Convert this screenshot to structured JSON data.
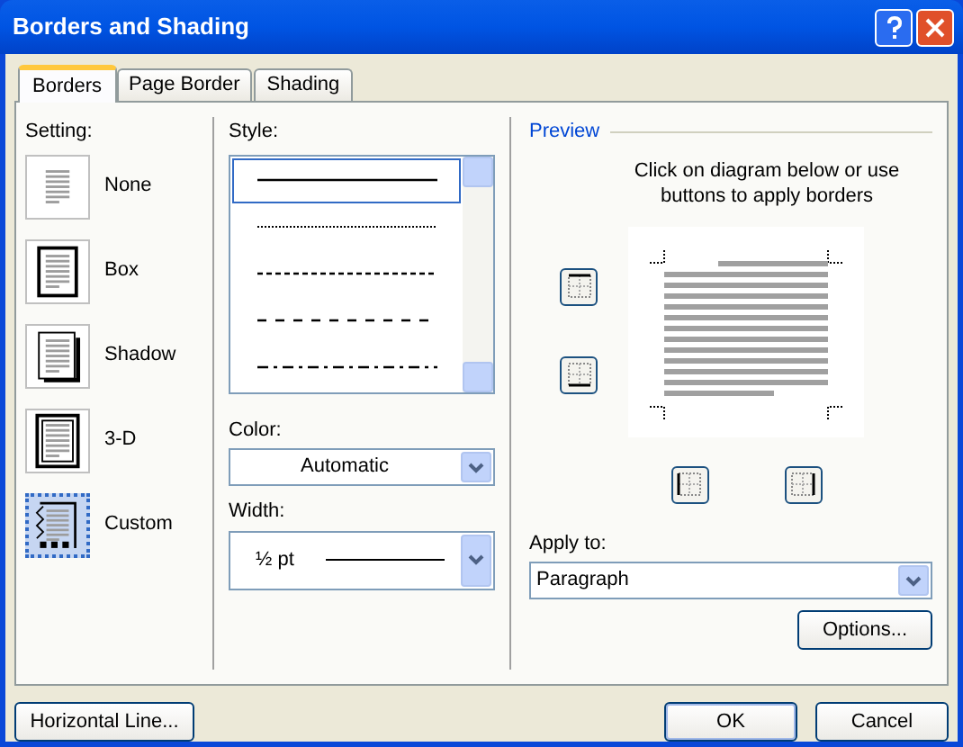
{
  "window": {
    "title": "Borders and Shading"
  },
  "tabs": [
    {
      "label": "Borders",
      "selected": true
    },
    {
      "label": "Page Border",
      "selected": false
    },
    {
      "label": "Shading",
      "selected": false
    }
  ],
  "setting": {
    "label": "Setting:",
    "options": [
      {
        "kind": "none",
        "label": "None",
        "selected": false
      },
      {
        "kind": "box",
        "label": "Box",
        "selected": false
      },
      {
        "kind": "shadow",
        "label": "Shadow",
        "selected": false
      },
      {
        "kind": "threed",
        "label": "3-D",
        "selected": false
      },
      {
        "kind": "custom",
        "label": "Custom",
        "selected": true
      }
    ]
  },
  "style": {
    "label": "Style:",
    "options": [
      {
        "kind": "solid",
        "selected": true
      },
      {
        "kind": "dotted",
        "selected": false
      },
      {
        "kind": "dashed",
        "selected": false
      },
      {
        "kind": "dash-long",
        "selected": false
      },
      {
        "kind": "dash-dot",
        "selected": false
      }
    ]
  },
  "color": {
    "label": "Color:",
    "value": "Automatic"
  },
  "width": {
    "label": "Width:",
    "value": "½ pt"
  },
  "preview": {
    "title": "Preview",
    "instructions": "Click on diagram below or use buttons to apply borders",
    "apply_to": {
      "label": "Apply to:",
      "value": "Paragraph"
    },
    "options_button": "Options..."
  },
  "buttons": {
    "horizontal_line": "Horizontal Line...",
    "ok": "OK",
    "cancel": "Cancel"
  }
}
